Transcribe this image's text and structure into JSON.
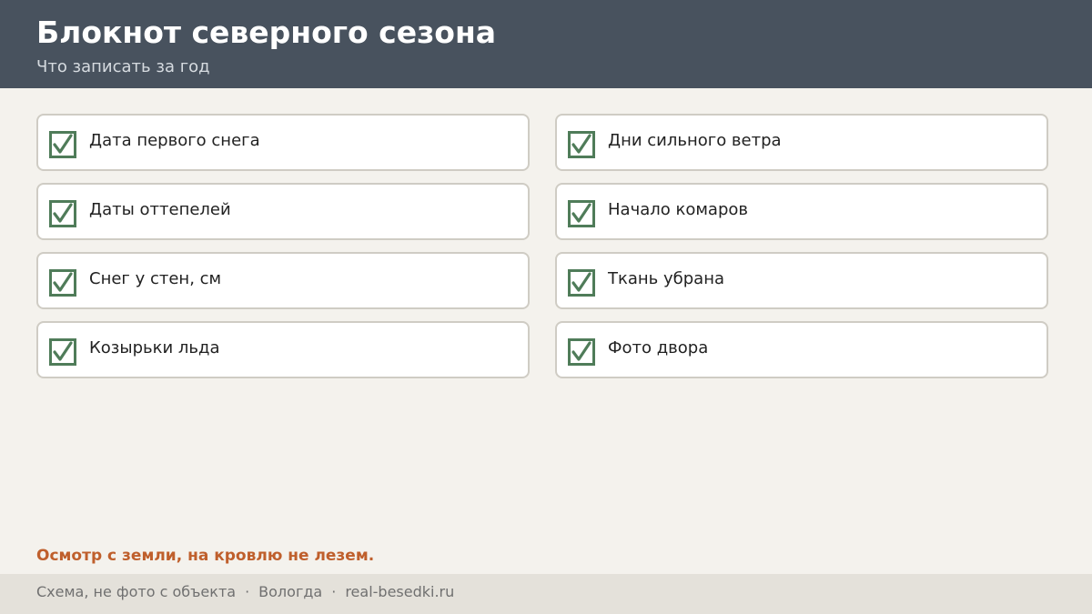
{
  "header": {
    "title": "Блокнот северного сезона",
    "subtitle": "Что записать за год"
  },
  "checklist": {
    "left": [
      {
        "label": "Дата первого снега",
        "checked": true
      },
      {
        "label": "Даты оттепелей",
        "checked": true
      },
      {
        "label": "Снег у стен, см",
        "checked": true
      },
      {
        "label": "Козырьки льда",
        "checked": true
      }
    ],
    "right": [
      {
        "label": "Дни сильного ветра",
        "checked": true
      },
      {
        "label": "Начало комаров",
        "checked": true
      },
      {
        "label": "Ткань убрана",
        "checked": true
      },
      {
        "label": "Фото двора",
        "checked": true
      }
    ]
  },
  "warning": "Осмотр с земли, на кровлю не лезем.",
  "footer": {
    "note": "Схема, не фото с объекта",
    "separator": "·",
    "city": "Вологда",
    "site": "real-besedki.ru"
  },
  "colors": {
    "header_bg": "#48525e",
    "page_bg": "#f4f2ed",
    "check": "#4f7c59",
    "warning": "#bf5f2c",
    "footer_bg": "#e4e1da"
  },
  "icons": {
    "checkbox": "checkbox-checked-icon"
  }
}
